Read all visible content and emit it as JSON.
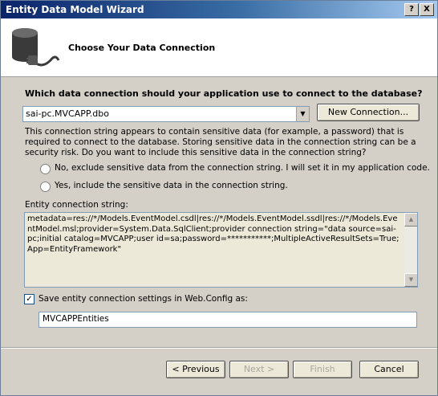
{
  "window": {
    "title": "Entity Data Model Wizard",
    "help_glyph": "?",
    "close_glyph": "X"
  },
  "header": {
    "title": "Choose Your Data Connection",
    "icon": "database-connection-icon"
  },
  "connection": {
    "question": "Which data connection should your application use to connect to the database?",
    "selected": "sai-pc.MVCAPP.dbo",
    "new_connection_label": "New Connection..."
  },
  "sensitive": {
    "info": "This connection string appears to contain sensitive data (for example, a password) that is required to connect to the database. Storing sensitive data in the connection string can be a security risk. Do you want to include this sensitive data in the connection string?",
    "option_no": "No, exclude sensitive data from the connection string. I will set it in my application code.",
    "option_yes": "Yes, include the sensitive data in the connection string."
  },
  "entity_connection": {
    "label": "Entity connection string:",
    "value": "metadata=res://*/Models.EventModel.csdl|res://*/Models.EventModel.ssdl|res://*/Models.EventModel.msl;provider=System.Data.SqlClient;provider connection string=\"data source=sai-pc;initial catalog=MVCAPP;user id=sa;password=***********;MultipleActiveResultSets=True;App=EntityFramework\""
  },
  "save": {
    "label": "Save entity connection settings in Web.Config as:",
    "checked": true,
    "name": "MVCAPPEntities"
  },
  "footer": {
    "previous": "< Previous",
    "next": "Next >",
    "finish": "Finish",
    "cancel": "Cancel"
  }
}
